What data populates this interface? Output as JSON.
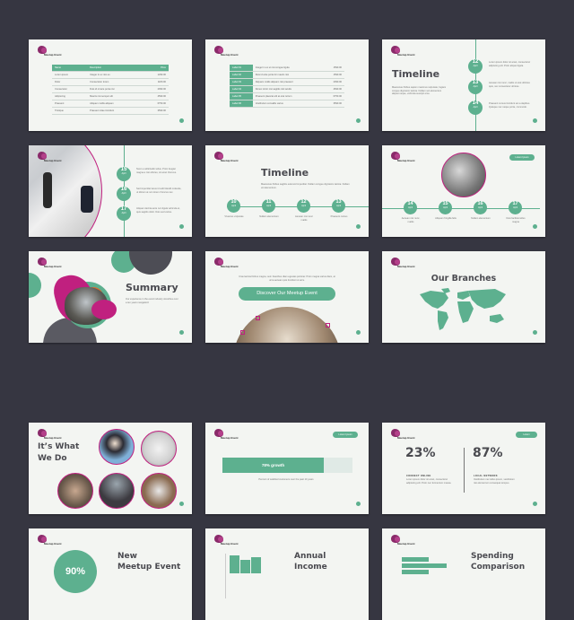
{
  "brand": {
    "name": "Meetup Event",
    "accent": "#5db08f",
    "magenta": "#c0207f",
    "dark": "#4a4a50",
    "background": "#363641"
  },
  "slide1": {
    "headers": [
      "Name",
      "Description",
      "Price"
    ],
    "rows": [
      [
        "Lorem ipsum",
        "Integer in ex nisi eu",
        "1290.00"
      ],
      [
        "Dolor",
        "Consectetur lorem",
        "1180.00"
      ],
      [
        "Consectetur",
        "Duis id ornare porta nisi",
        "2090.00"
      ],
      [
        "Adipiscing",
        "Mauris nisi semper elit",
        "4590.00"
      ],
      [
        "Praesent",
        "Aliquam mollis aliquam",
        "6750.00"
      ],
      [
        "Tristique",
        "Praesent vitae tincidunt",
        "3590.00"
      ]
    ]
  },
  "slide2": {
    "rows": [
      [
        "Label 01",
        "Integer in ex ut nisi congue ligula",
        "1590.00"
      ],
      [
        "Label 02",
        "Duis id ante porta for mauris nisi",
        "1590.00"
      ],
      [
        "Label 03",
        "Aliquam mollis aliquam nisi praesent",
        "2090.00"
      ],
      [
        "Label 04",
        "Donec tortor nisi sagittis nisl iaculis",
        "4690.00"
      ],
      [
        "Label 05",
        "Praesent placerat elit at erat rutrum",
        "6750.00"
      ],
      [
        "Label 06",
        "Vestibulum convallis varius",
        "3590.00"
      ]
    ]
  },
  "slide3": {
    "title": "Timeline",
    "body": "Maecenas finibus sapien maximus vulputate, fugiam congue dignissim lacinia. Nullam vel elementum aliquet neque, vehicula suscipit eros.",
    "items": [
      {
        "day": "12",
        "month": "April",
        "text": "Lorem ipsum dolor sit amet, consectetur adipiscing elit. Proin aliquet ligula."
      },
      {
        "day": "13",
        "month": "April",
        "text": "Aenean nisi nunc, mattis ut erat ultricies quis, nec consectetur ultrices."
      },
      {
        "day": "14",
        "month": "April",
        "text": "Praesent cursus tincidunt est a dapibus. Quisque nec neque porta, commodo."
      }
    ]
  },
  "slide4": {
    "items": [
      {
        "day": "15",
        "month": "April",
        "text": "Nunc a sollicitudin tellus. Proin feugiat magna a nisi ultrices, sit amet rhoncus."
      },
      {
        "day": "16",
        "month": "April",
        "text": "Sed imperdiet lacus id velit blandit molestie, ut dictum at non lorem rhoncus nec."
      },
      {
        "day": "17",
        "month": "April",
        "text": "Aliquam lacinia ante non ligula vehicula et, quis sagittis dolor. Duis sed varius."
      }
    ]
  },
  "slide5": {
    "title": "Timeline",
    "body": "Maecenas finibus sagittis euismod imperdiet. Nullam congue dignissim lacinia. Nullam vel elementum.",
    "items": [
      {
        "day": "10",
        "month": "April",
        "text": "Vivamus vulputate"
      },
      {
        "day": "11",
        "month": "April",
        "text": "Nullam elementum"
      },
      {
        "day": "12",
        "month": "April",
        "text": "Aenean nisi nunc mattis"
      },
      {
        "day": "13",
        "month": "April",
        "text": "Praesent cursus"
      }
    ]
  },
  "slide6": {
    "button": "Lorem Ipsum",
    "items": [
      {
        "day": "14",
        "month": "April",
        "text": "Aenean nisi nunc, mattis"
      },
      {
        "day": "15",
        "month": "April",
        "text": "Aliquam fringilla felis"
      },
      {
        "day": "16",
        "month": "April",
        "text": "Nullam elementum"
      },
      {
        "day": "17",
        "month": "April",
        "text": "Duis facilisis tellus magna"
      }
    ]
  },
  "slide7": {
    "title": "Summary",
    "body": "Our experience in the event industry stretches over a ten years navigation!"
  },
  "slide8": {
    "body": "Cras lacinia finibus magna, sed. Faucibus diam egestas pulvinar. Proin magna varius diam, at urna aenean quis tincidunt ut arcu.",
    "button": "Discover Our Meetup Event"
  },
  "slide9": {
    "title": "Our Branches"
  },
  "slide10": {
    "title_line1": "It’s What",
    "title_line2": "We Do"
  },
  "slide11": {
    "button": "Lorem Ipsum",
    "bar_label": "78% growth",
    "growth_percent": 78,
    "caption": "Percent of satisfied customers over the past 10 years"
  },
  "slide12": {
    "button": "Lorem",
    "stats": [
      {
        "value": "23%",
        "label": "CONNECT ONLINE",
        "text": "Lorem ipsum dolor sit amet, consectetur adipiscing elit. Proin nec fermentum massa."
      },
      {
        "value": "87%",
        "label": "LOCAL NETWORK",
        "text": "Vestibulum nec tellus ipsum, vestibulum nisi elementum consequat tempus."
      }
    ]
  },
  "slide13": {
    "value": "90%",
    "title_line1": "New",
    "title_line2": "Meetup Event"
  },
  "slide14": {
    "title_line1": "Annual",
    "title_line2": "Income",
    "bars": [
      0.9,
      0.7,
      0.8
    ]
  },
  "slide15": {
    "title_line1": "Spending",
    "title_line2": "Comparison",
    "bars": [
      0.55,
      0.9,
      0.55
    ]
  }
}
